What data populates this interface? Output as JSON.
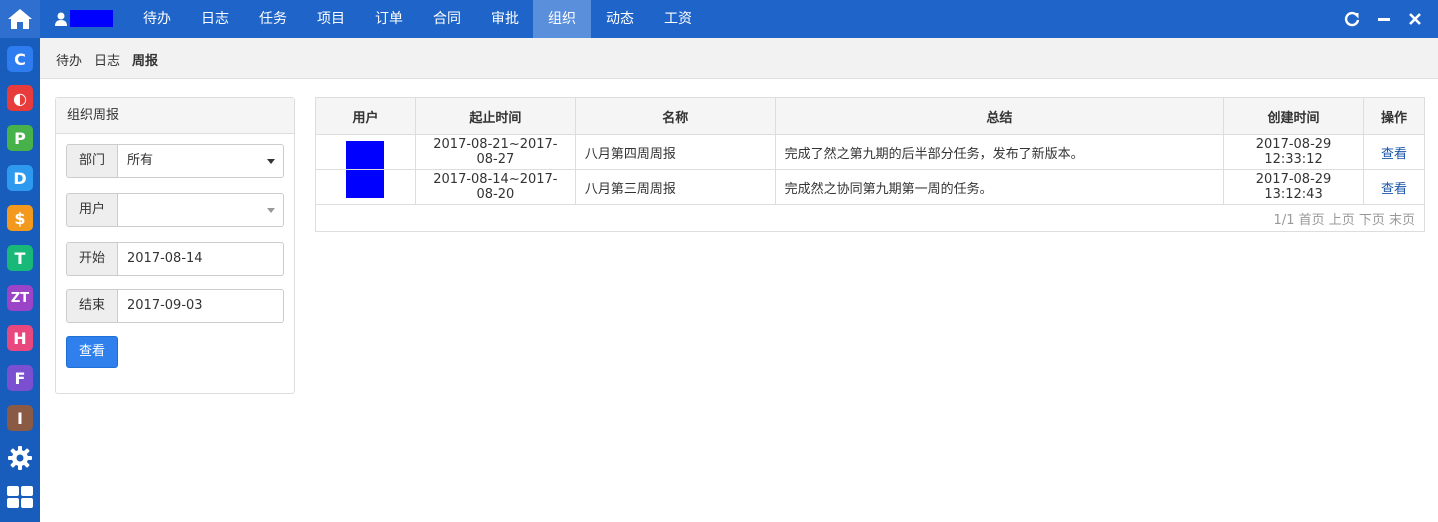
{
  "leftbar": {
    "apps": [
      {
        "name": "app-c-icon",
        "glyph": "C",
        "color": "#2d7cf0"
      },
      {
        "name": "app-o-icon",
        "glyph": "◐",
        "color": "#e83b3b"
      },
      {
        "name": "app-p-icon",
        "glyph": "P",
        "color": "#48b24a"
      },
      {
        "name": "app-d-icon",
        "glyph": "D",
        "color": "#2d9af0"
      },
      {
        "name": "app-s-icon",
        "glyph": "$",
        "color": "#f39a1e"
      },
      {
        "name": "app-t-icon",
        "glyph": "T",
        "color": "#17b878"
      },
      {
        "name": "app-zt-icon",
        "glyph": "ZT",
        "color": "#9b44c8"
      },
      {
        "name": "app-h-icon",
        "glyph": "H",
        "color": "#e9487f"
      },
      {
        "name": "app-f-icon",
        "glyph": "F",
        "color": "#7a4fd0"
      },
      {
        "name": "app-i-icon",
        "glyph": "I",
        "color": "#8a5a44"
      }
    ]
  },
  "nav": {
    "items": [
      "待办",
      "日志",
      "任务",
      "项目",
      "订单",
      "合同",
      "审批",
      "组织",
      "动态",
      "工资"
    ],
    "active": "组织"
  },
  "breadcrumb": {
    "items": [
      "待办",
      "日志"
    ],
    "current": "周报"
  },
  "filter": {
    "title": "组织周报",
    "dept_label": "部门",
    "dept_value": "所有",
    "user_label": "用户",
    "user_value": "",
    "start_label": "开始",
    "start_value": "2017-08-14",
    "end_label": "结束",
    "end_value": "2017-09-03",
    "submit_label": "查看"
  },
  "table": {
    "headers": [
      "用户",
      "起止时间",
      "名称",
      "总结",
      "创建时间",
      "操作"
    ],
    "rows": [
      {
        "period": "2017-08-21~2017-08-27",
        "name": "八月第四周周报",
        "summary": "完成了然之第九期的后半部分任务，发布了新版本。",
        "created": "2017-08-29 12:33:12",
        "action": "查看"
      },
      {
        "period": "2017-08-14~2017-08-20",
        "name": "八月第三周周报",
        "summary": "完成然之协同第九期第一周的任务。",
        "created": "2017-08-29 13:12:43",
        "action": "查看"
      }
    ],
    "pager": "1/1 首页 上页 下页 末页"
  },
  "colors": {
    "topbar": "#1f64c8",
    "leftbar": "#185cbc",
    "accent": "#2f80ec",
    "redaction": "#0000ff"
  }
}
